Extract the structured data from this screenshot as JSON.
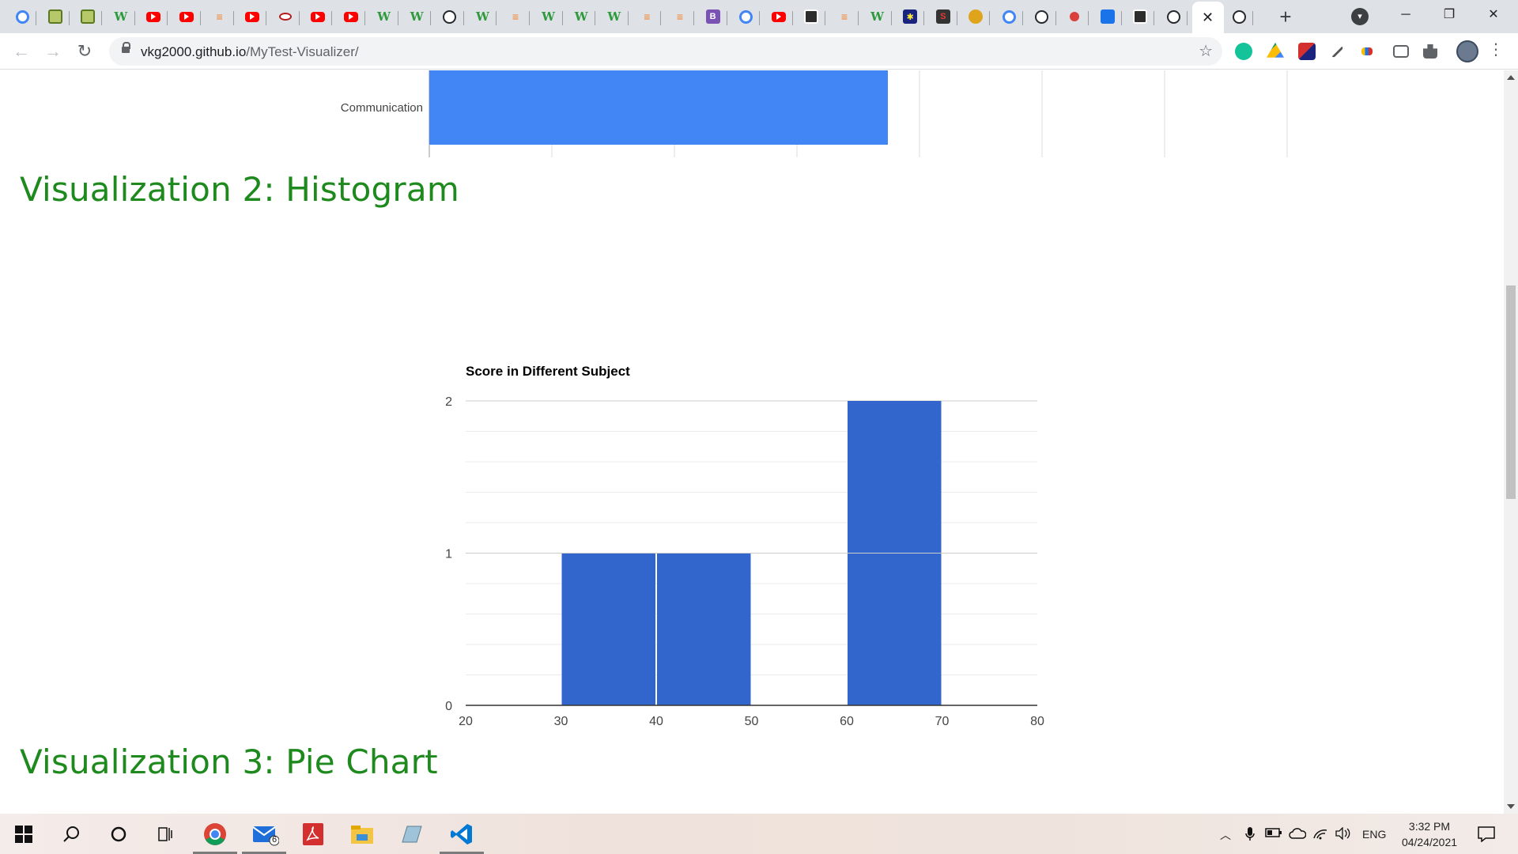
{
  "browser": {
    "tabs": [
      {
        "icon": "google-icon",
        "cls": "fav-google",
        "glyph": ""
      },
      {
        "icon": "heart-icon",
        "cls": "fav-heart",
        "glyph": ""
      },
      {
        "icon": "heart-icon",
        "cls": "fav-heart",
        "glyph": ""
      },
      {
        "icon": "w-icon",
        "cls": "fav-w",
        "glyph": "W"
      },
      {
        "icon": "youtube-icon",
        "cls": "fav-yt",
        "glyph": ""
      },
      {
        "icon": "youtube-icon",
        "cls": "fav-yt",
        "glyph": ""
      },
      {
        "icon": "stackoverflow-icon",
        "cls": "fav-so",
        "glyph": "≡"
      },
      {
        "icon": "youtube-icon",
        "cls": "fav-yt",
        "glyph": ""
      },
      {
        "icon": "eye-icon",
        "cls": "fav-eye",
        "glyph": ""
      },
      {
        "icon": "youtube-icon",
        "cls": "fav-yt",
        "glyph": ""
      },
      {
        "icon": "youtube-icon",
        "cls": "fav-yt",
        "glyph": ""
      },
      {
        "icon": "w-icon",
        "cls": "fav-w",
        "glyph": "W"
      },
      {
        "icon": "w-icon",
        "cls": "fav-w",
        "glyph": "W"
      },
      {
        "icon": "github-icon",
        "cls": "fav-gh",
        "glyph": ""
      },
      {
        "icon": "w-icon",
        "cls": "fav-w",
        "glyph": "W"
      },
      {
        "icon": "stackoverflow-icon",
        "cls": "fav-so",
        "glyph": "≡"
      },
      {
        "icon": "w-icon",
        "cls": "fav-w",
        "glyph": "W"
      },
      {
        "icon": "w-icon",
        "cls": "fav-w",
        "glyph": "W"
      },
      {
        "icon": "w-icon",
        "cls": "fav-w",
        "glyph": "W"
      },
      {
        "icon": "stackoverflow-icon",
        "cls": "fav-so",
        "glyph": "≡"
      },
      {
        "icon": "stackoverflow-icon",
        "cls": "fav-so",
        "glyph": "≡"
      },
      {
        "icon": "bootstrap-icon",
        "cls": "fav-b",
        "glyph": "B"
      },
      {
        "icon": "google-icon",
        "cls": "fav-google",
        "glyph": ""
      },
      {
        "icon": "youtube-icon",
        "cls": "fav-yt",
        "glyph": ""
      },
      {
        "icon": "code-icon",
        "cls": "fav-code",
        "glyph": ""
      },
      {
        "icon": "stackoverflow-icon",
        "cls": "fav-so",
        "glyph": "≡"
      },
      {
        "icon": "w-icon",
        "cls": "fav-w",
        "glyph": "W"
      },
      {
        "icon": "sun-icon",
        "cls": "fav-sun",
        "glyph": "✱"
      },
      {
        "icon": "rs-icon",
        "cls": "fav-rs",
        "glyph": "S"
      },
      {
        "icon": "coin-icon",
        "cls": "fav-yellow",
        "glyph": ""
      },
      {
        "icon": "google-icon",
        "cls": "fav-google",
        "glyph": ""
      },
      {
        "icon": "github-icon",
        "cls": "fav-gh",
        "glyph": ""
      },
      {
        "icon": "record-icon",
        "cls": "fav-red",
        "glyph": ""
      },
      {
        "icon": "chat-icon",
        "cls": "fav-blue",
        "glyph": ""
      },
      {
        "icon": "code-icon",
        "cls": "fav-code",
        "glyph": ""
      },
      {
        "icon": "github-icon",
        "cls": "fav-gh",
        "glyph": ""
      },
      {
        "icon": "close-icon",
        "cls": "active",
        "glyph": "✕"
      },
      {
        "icon": "github-icon",
        "cls": "fav-gh",
        "glyph": ""
      }
    ],
    "new_tab_label": "+",
    "window_controls": {
      "minimize": "─",
      "restore": "❐",
      "close": "✕"
    },
    "nav": {
      "back": "←",
      "forward": "→",
      "reload": "↻"
    },
    "url_host": "vkg2000.github.io",
    "url_path": "/MyTest-Visualizer/",
    "star": "☆",
    "menu": "⋮"
  },
  "page": {
    "bar_chart_partial": {
      "category": "Communication"
    },
    "section2_title": "Visualization 2: Histogram",
    "section3_title": "Visualization 3: Pie Chart"
  },
  "chart_data": {
    "type": "bar",
    "title": "Score in Different Subject",
    "x_ticks": [
      "20",
      "30",
      "40",
      "50",
      "60",
      "70",
      "80"
    ],
    "y_ticks": [
      "0",
      "1",
      "2"
    ],
    "xlim": [
      20,
      80
    ],
    "ylim": [
      0,
      2
    ],
    "bins": [
      {
        "x0": 30,
        "x1": 40,
        "count": 1
      },
      {
        "x0": 40,
        "x1": 50,
        "count": 1
      },
      {
        "x0": 60,
        "x1": 70,
        "count": 2
      }
    ],
    "bar_color": "#3366cc",
    "grid": true
  },
  "taskbar": {
    "mail_badge": "6",
    "language": "ENG",
    "time": "3:32 PM",
    "date": "04/24/2021"
  }
}
